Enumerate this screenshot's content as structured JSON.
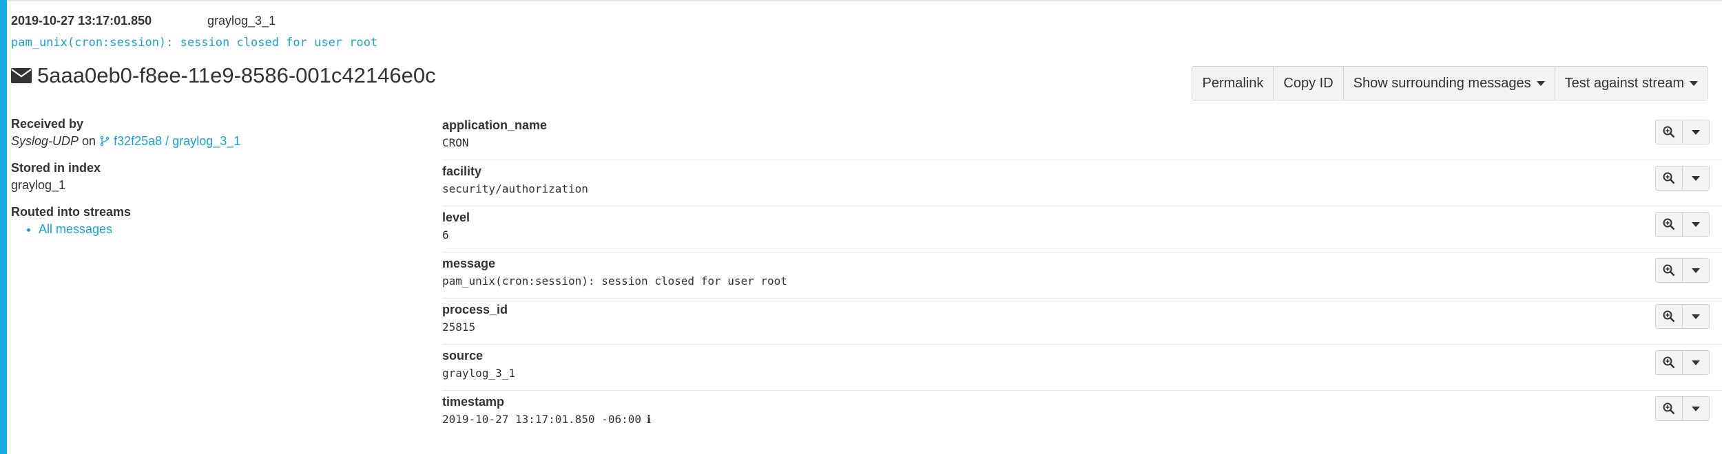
{
  "header": {
    "timestamp": "2019-10-27 13:17:01.850",
    "source_node": "graylog_3_1",
    "raw_message": "pam_unix(cron:session): session closed for user root",
    "message_id": "5aaa0eb0-f8ee-11e9-8586-001c42146e0c",
    "icon": "envelope-icon"
  },
  "toolbar": {
    "permalink_label": "Permalink",
    "copy_id_label": "Copy ID",
    "surrounding_label": "Show surrounding messages",
    "test_stream_label": "Test against stream"
  },
  "details": {
    "received_by_label": "Received by",
    "input_name": "Syslog-UDP",
    "on_word": "on",
    "node_link": "f32f25a8 / graylog_3_1",
    "stored_label": "Stored in index",
    "index_name": "graylog_1",
    "routed_label": "Routed into streams",
    "streams": [
      "All messages"
    ]
  },
  "fields": [
    {
      "name": "application_name",
      "value": "CRON"
    },
    {
      "name": "facility",
      "value": "security/authorization"
    },
    {
      "name": "level",
      "value": "6"
    },
    {
      "name": "message",
      "value": "pam_unix(cron:session): session closed for user root"
    },
    {
      "name": "process_id",
      "value": "25815"
    },
    {
      "name": "source",
      "value": "graylog_3_1"
    },
    {
      "name": "timestamp",
      "value": "2019-10-27 13:17:01.850 -06:00"
    }
  ],
  "colors": {
    "accent": "#16ace3",
    "link": "#16a3d4"
  }
}
